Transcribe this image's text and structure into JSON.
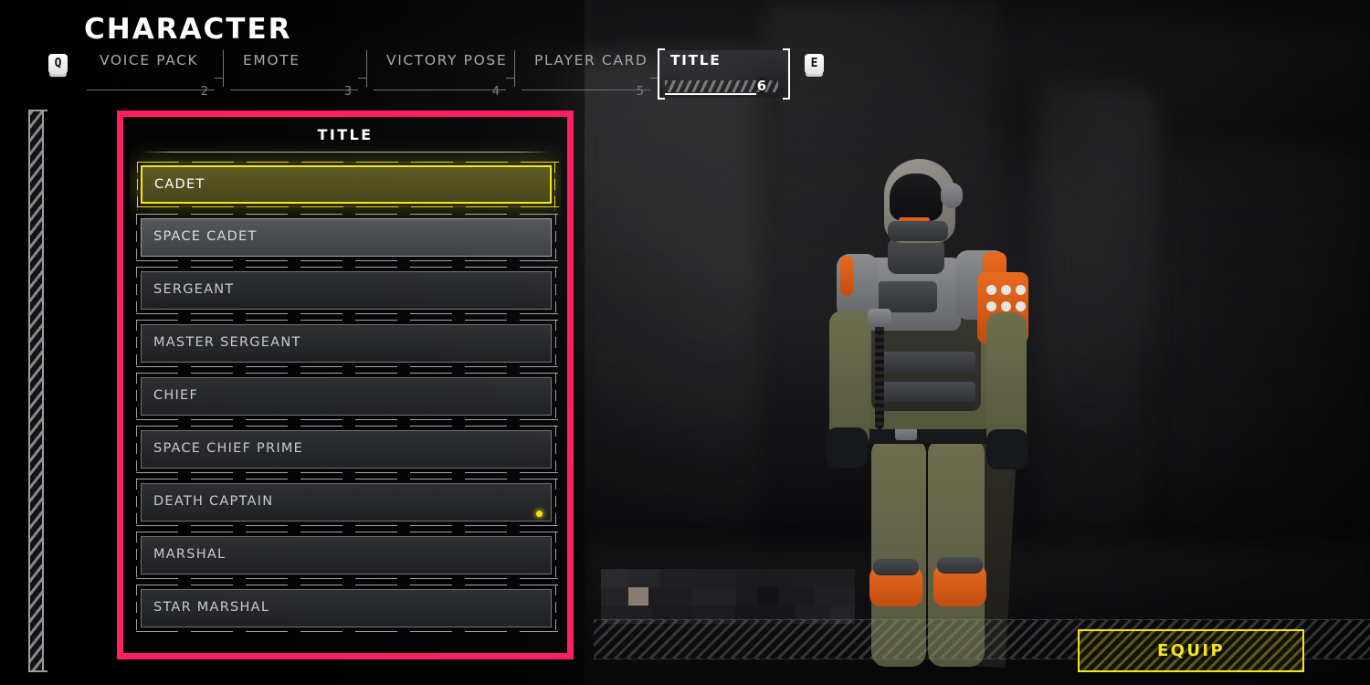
{
  "header": {
    "title": "CHARACTER",
    "prev_key": "Q",
    "next_key": "E",
    "prev_key_icon": "key-q-icon",
    "next_key_icon": "key-e-icon"
  },
  "tabs": [
    {
      "label": "VOICE PACK",
      "number": "2",
      "active": false
    },
    {
      "label": "EMOTE",
      "number": "3",
      "active": false
    },
    {
      "label": "VICTORY POSE",
      "number": "4",
      "active": false
    },
    {
      "label": "PLAYER CARD",
      "number": "5",
      "active": false
    },
    {
      "label": "TITLE",
      "number": "6",
      "active": true
    }
  ],
  "panel": {
    "title": "TITLE",
    "items": [
      {
        "label": "CADET",
        "state": "selected",
        "marker": false
      },
      {
        "label": "SPACE CADET",
        "state": "hover",
        "marker": false
      },
      {
        "label": "SERGEANT",
        "state": "normal",
        "marker": false
      },
      {
        "label": "MASTER SERGEANT",
        "state": "normal",
        "marker": false
      },
      {
        "label": "CHIEF",
        "state": "normal",
        "marker": false
      },
      {
        "label": "SPACE CHIEF PRIME",
        "state": "normal",
        "marker": false
      },
      {
        "label": "DEATH CAPTAIN",
        "state": "normal",
        "marker": true
      },
      {
        "label": "MARSHAL",
        "state": "normal",
        "marker": false
      },
      {
        "label": "STAR MARSHAL",
        "state": "normal",
        "marker": false
      }
    ]
  },
  "actions": {
    "equip_label": "EQUIP"
  },
  "colors": {
    "highlight_box": "#ff2060",
    "selection_yellow": "#f2e81a",
    "marker_dot": "#f4e11a",
    "text_primary": "#ffffff",
    "text_secondary": "#c8cacd",
    "tab_inactive": "#a6a8ab"
  }
}
